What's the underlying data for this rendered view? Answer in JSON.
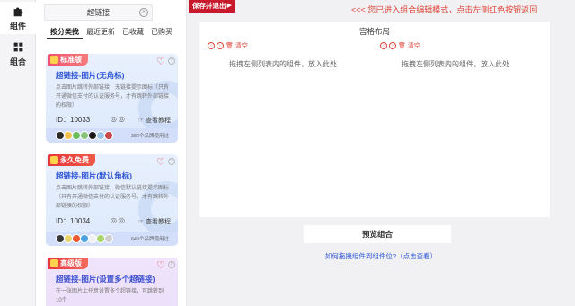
{
  "rail": {
    "items": [
      {
        "label": "组件",
        "icon": "puzzle-icon",
        "active": true
      },
      {
        "label": "组合",
        "icon": "blocks-icon",
        "active": false
      }
    ]
  },
  "panel": {
    "search_value": "超链接",
    "tabs": [
      {
        "label": "按分类找",
        "active": true
      },
      {
        "label": "最近更新",
        "active": false
      },
      {
        "label": "已收藏",
        "active": false
      },
      {
        "label": "已购买",
        "active": false
      }
    ],
    "cards": [
      {
        "badge": "标准版",
        "title": "超链接-图片(无角标)",
        "desc": "点击图片跳转外部链接，无链接提示图标（只有开通微信支付的认证服务号，才有跳转外部链接的权限）",
        "id": "ID：10033",
        "tutorial": "查看教程",
        "count": "382个品牌使用过"
      },
      {
        "badge": "永久免费",
        "title": "超链接-图片(默认角标)",
        "desc": "点击图片跳转外部链接，微信默认链接提示图标（只有开通微信支付的认证服务号，才有跳转外部链接的权限）",
        "id": "ID：10034",
        "tutorial": "查看教程",
        "count": "649个品牌使用过"
      },
      {
        "badge": "高级版",
        "title": "超链接-图片(设置多个超链接)",
        "desc": "在一张图片上任意设置多个超链接，可跳转到10个"
      }
    ]
  },
  "main": {
    "save_label": "保存并退出",
    "notice": "<<< 您已进入组合编辑模式，点击左侧红色按钮返回",
    "canvas_title": "宫格布局",
    "columns": [
      {
        "clear": "清空",
        "drop": "拖拽左侧列表内的组件，放入此处"
      },
      {
        "clear": "清空",
        "drop": "拖拽左侧列表内的组件，放入此处"
      }
    ],
    "preview_label": "预览组合",
    "howto": "如何拖拽组件到组件位?（点击查看）"
  },
  "colors": {
    "accent_red": "#c8182b",
    "notice_red": "#e0453a",
    "title_blue": "#2e55d6"
  }
}
